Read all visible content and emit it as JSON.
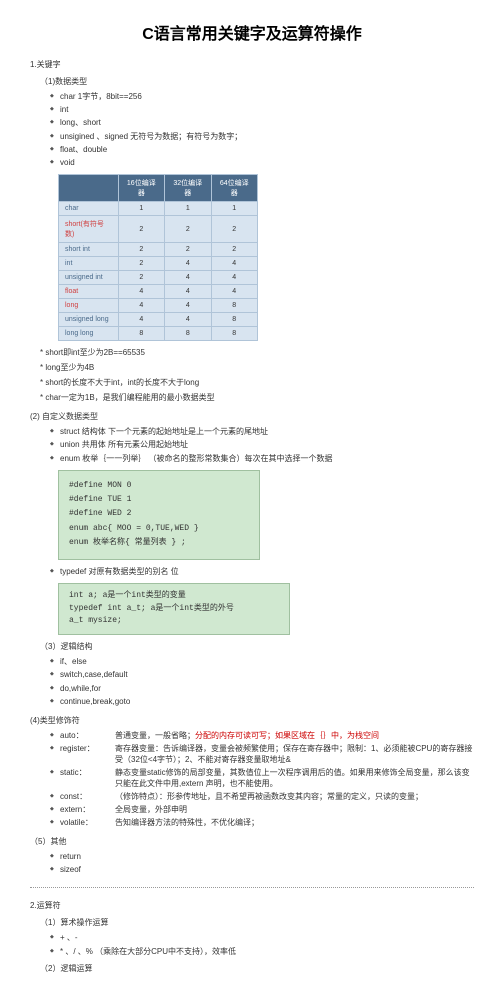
{
  "title": "C语言常用关键字及运算符操作",
  "s1": {
    "num": "1.关键字",
    "sub1": "（1)数据类型"
  },
  "dt_basic": [
    "char                     1字节，8bit==256",
    "int",
    "long、short",
    "unsigined 、signed     无符号为数据；有符号为数字；",
    "float、double",
    "void"
  ],
  "table": {
    "headers": [
      "",
      "16位编译器",
      "32位编译器",
      "64位编译器"
    ],
    "rows": [
      [
        "char",
        "1",
        "1",
        "1"
      ],
      [
        "short(有符号数)",
        "2",
        "2",
        "2"
      ],
      [
        "short int",
        "2",
        "2",
        "2"
      ],
      [
        "int",
        "2",
        "4",
        "4"
      ],
      [
        "unsigned int",
        "2",
        "4",
        "4"
      ],
      [
        "float",
        "4",
        "4",
        "4"
      ],
      [
        "long",
        "4",
        "4",
        "8"
      ],
      [
        "unsigned long",
        "4",
        "4",
        "8"
      ],
      [
        "long long",
        "8",
        "8",
        "8"
      ]
    ]
  },
  "notes1": [
    "* short即int至少为2B==65535",
    "* long至少为4B",
    "* short的长度不大于int，int的长度不大于long",
    "* char一定为1B，是我们编程能用的最小数据类型"
  ],
  "s1_2": "(2) 自定义数据类型",
  "custom_types": [
    "struct     结构体      下一个元素的起始地址是上一个元素的尾地址",
    "union     共用体      所有元素公用起始地址",
    "enum     枚举｛一一列举｝ （被命名的整形常数集合）每次在其中选择一个数据"
  ],
  "codebox1": [
    "#define MON  0",
    "#define TUE   1",
    "#define WED  2",
    "",
    "enum abc{ MOO = 0,TUE,WED }",
    "",
    "enum 枚举名称{ 常量列表 } ;"
  ],
  "typedef_line": "typedef    对原有数据类型的别名          位",
  "codebox2": [
    "int a;                  a是一个int类型的变量",
    "typedef int a_t;      a是一个int类型的外号",
    "a_t mysize;"
  ],
  "s1_3": "（3）逻辑结构",
  "logic": [
    "if、else",
    "switch,case,default",
    "do,while,for",
    "continue,break,goto"
  ],
  "s1_4": "(4)类型修饰符",
  "modifiers": [
    {
      "k": "auto：",
      "v": "普通变量，一般省略；<span class='red'>分配的内存可读可写；如果区域在｛｝中，为栈空间</span>"
    },
    {
      "k": "register：",
      "v": "寄存器变量：告诉编译器，变量会被频繁使用；保存在寄存器中；限制：1、必须能被CPU的寄存器接受（32位&lt;4字节）；2、不能对寄存器变量取地址&amp;"
    },
    {
      "k": "static：",
      "v": "静态变量static修饰的局部变量，其数值位上一次程序调用后的值。如果用来修饰全局变量，那么该变只能在此文件中用,extern 声明，也不能使用。"
    },
    {
      "k": "const：",
      "v": "（修饰特点）：形参传地址，且不希望再被函数改变其内容；常量的定义，只读的变量；"
    },
    {
      "k": "extern：",
      "v": "全局变量，外部申明"
    },
    {
      "k": "volatile：",
      "v": "告知编译器方法的特殊性，不优化编译；"
    }
  ],
  "s1_5": "（5）其他",
  "other": [
    "return",
    "sizeof"
  ],
  "s2": "2.运算符",
  "s2_1": "（1）算术操作运算",
  "arith": [
    "+ 、-",
    "* 、/ 、%   （乘除在大部分CPU中不支持），效率低"
  ],
  "s2_2": "（2）逻辑运算"
}
